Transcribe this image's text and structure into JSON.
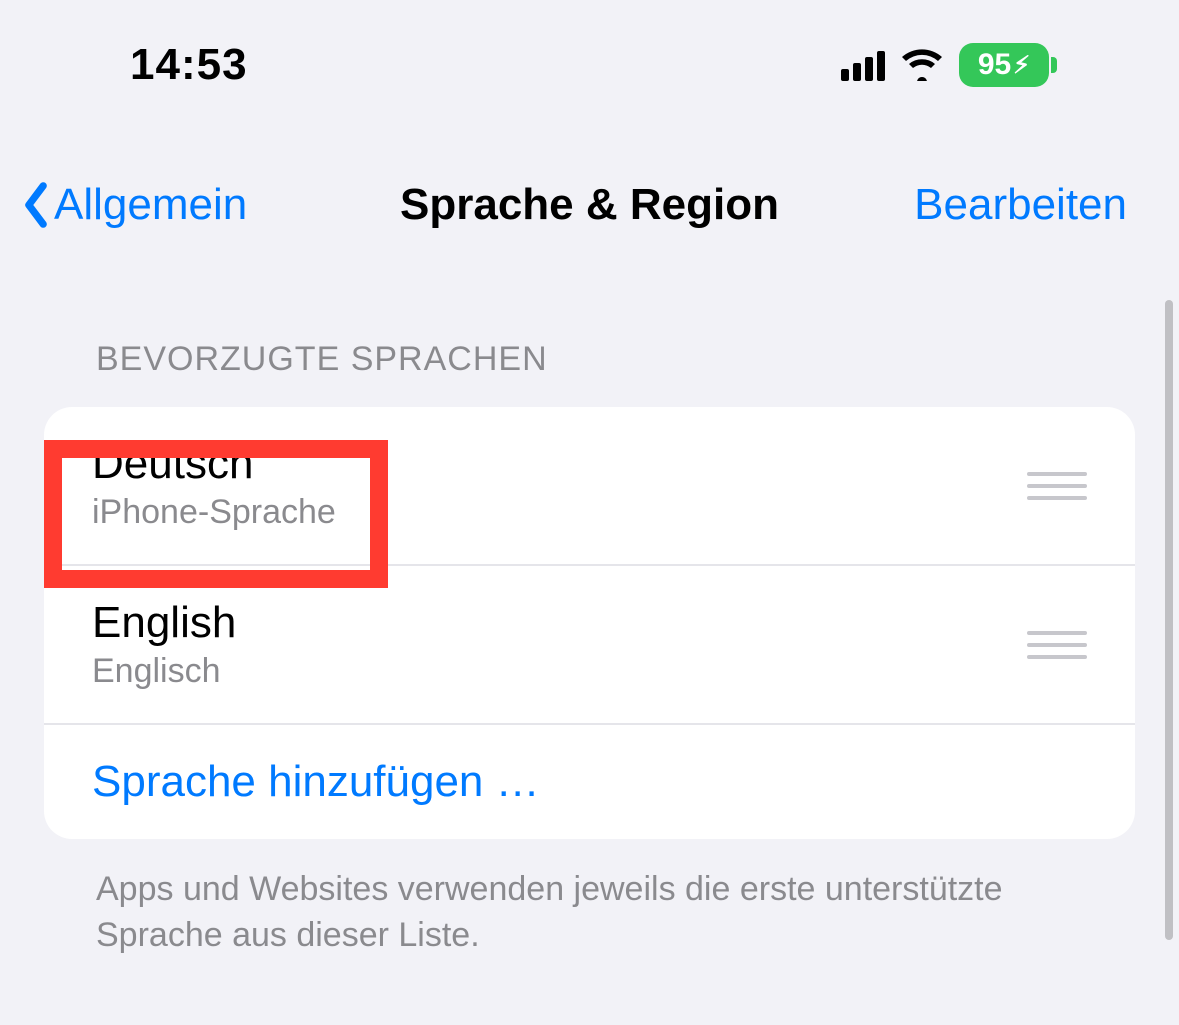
{
  "statusBar": {
    "time": "14:53",
    "batteryPercent": "95"
  },
  "nav": {
    "back": "Allgemein",
    "title": "Sprache & Region",
    "edit": "Bearbeiten"
  },
  "section": {
    "header": "BEVORZUGTE SPRACHEN",
    "footer": "Apps und Websites verwenden jeweils die erste unterstützte Sprache aus dieser Liste."
  },
  "languages": [
    {
      "name": "Deutsch",
      "sub": "iPhone-Sprache"
    },
    {
      "name": "English",
      "sub": "Englisch"
    }
  ],
  "addLanguage": "Sprache hinzufügen …"
}
